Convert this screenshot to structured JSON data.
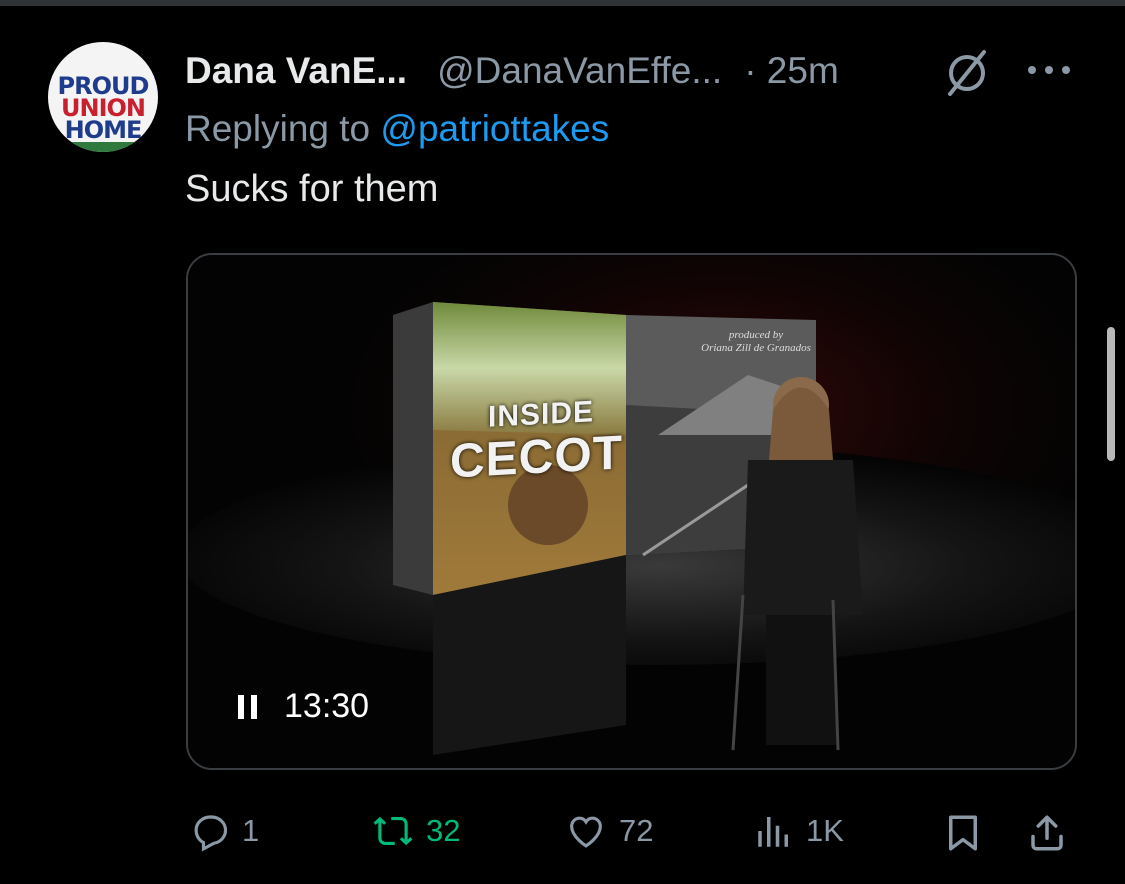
{
  "tweet": {
    "avatar": {
      "line1": "PROUD",
      "line2": "UNION",
      "line3": "HOME"
    },
    "display_name": "Dana VanE...",
    "handle": "@DanaVanEffe...",
    "time": "· 25m",
    "replying_prefix": "Replying to",
    "replying_to": "@patriottakes",
    "text": "Sucks for them",
    "icons": {
      "grok": "slashed-circle-icon",
      "more": "more-dots-icon"
    }
  },
  "video": {
    "cover_title_line1": "INSIDE",
    "cover_title_line2": "CECOT",
    "credits_line1": "produced by",
    "credits_line2": "Oriana Zill de Granados",
    "state": "playing",
    "elapsed": "13:30"
  },
  "actions": {
    "reply_count": "1",
    "repost_count": "32",
    "like_count": "72",
    "views_count": "1K",
    "colors": {
      "repost_active": "#00ba7c",
      "muted": "#8b98a5",
      "link": "#1d9bf0"
    }
  }
}
